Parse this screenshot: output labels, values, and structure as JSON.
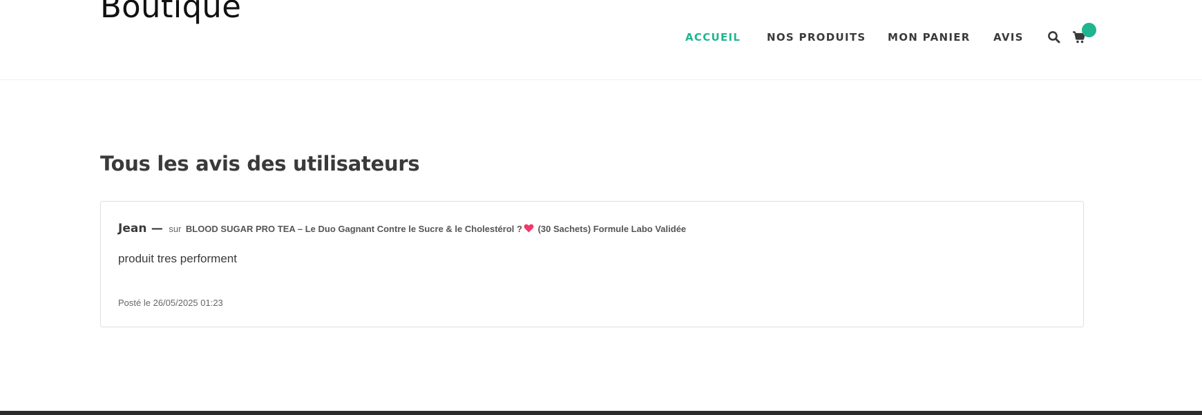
{
  "header": {
    "site_title": "Boutique",
    "nav": [
      {
        "label": "ACCUEIL",
        "active": true
      },
      {
        "label": "NOS PRODUITS",
        "active": false
      },
      {
        "label": "MON PANIER",
        "active": false
      },
      {
        "label": "AVIS",
        "active": false
      }
    ],
    "icons": [
      "search-icon",
      "cart-icon"
    ],
    "accent_color": "#1fb591"
  },
  "main": {
    "title": "Tous les avis des utilisateurs",
    "reviews": [
      {
        "author": "Jean",
        "separator": "—",
        "on_word": "sur",
        "product_name_part1": "BLOOD SUGAR PRO TEA – Le Duo Gagnant Contre le Sucre & le Cholestérol ?",
        "product_emoji": "heart-icon",
        "product_name_part2": "(30 Sachets) Formule Labo Validée",
        "text": "produit tres performent",
        "date": "Posté le 26/05/2025 01:23"
      }
    ]
  }
}
